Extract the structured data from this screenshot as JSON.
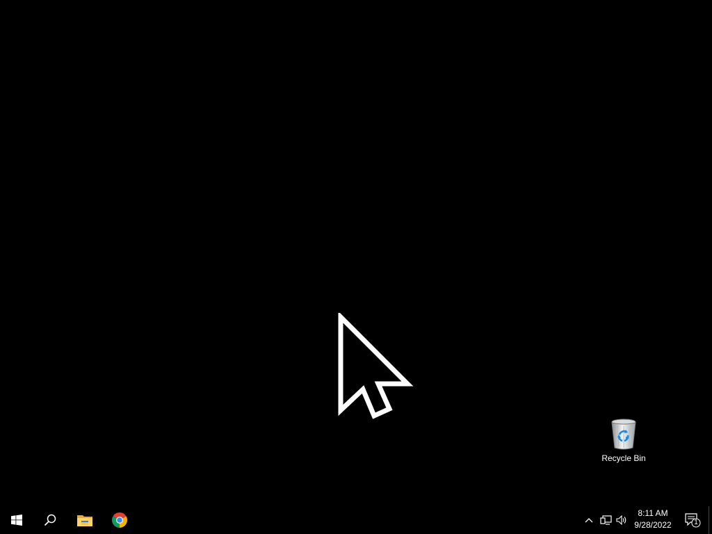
{
  "desktop": {
    "background_color": "#000000",
    "icons": [
      {
        "label": "Recycle Bin",
        "icon": "recycle-bin-icon"
      }
    ],
    "cursor": {
      "icon": "arrow-pointer-icon"
    }
  },
  "taskbar": {
    "background_color": "#000000",
    "pinned": [
      {
        "name": "Start",
        "icon": "windows-logo-icon"
      },
      {
        "name": "Search",
        "icon": "search-icon"
      },
      {
        "name": "File Explorer",
        "icon": "folder-icon"
      },
      {
        "name": "Google Chrome",
        "icon": "chrome-icon"
      }
    ],
    "tray": {
      "icons": [
        "chevron-up-icon",
        "network-icon",
        "volume-icon"
      ],
      "time": "8:11 AM",
      "date": "9/28/2022",
      "notification_count": "1"
    }
  }
}
